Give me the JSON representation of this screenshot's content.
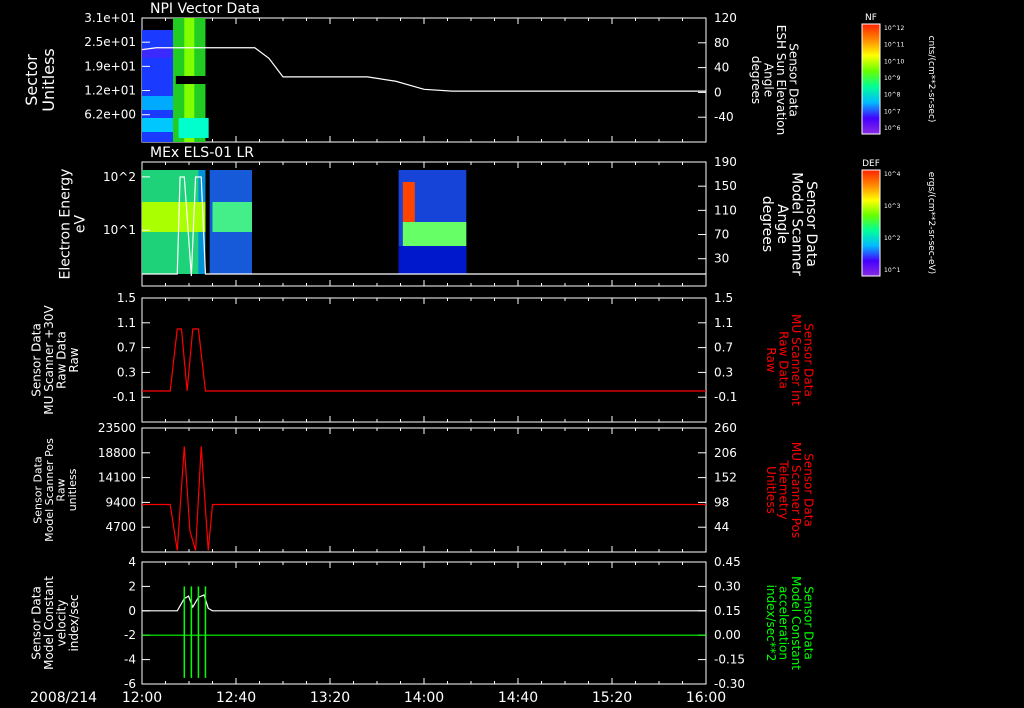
{
  "date_label": "2008/214",
  "time_ticks": [
    "12:00",
    "12:40",
    "13:20",
    "14:00",
    "14:40",
    "15:20",
    "16:00"
  ],
  "colorbars": [
    {
      "tag": "NF",
      "units": "cnts/(cm**2-sr-sec)",
      "labels": [
        "10^12",
        "10^11",
        "10^10",
        "10^9",
        "10^8",
        "10^7",
        "10^6"
      ]
    },
    {
      "tag": "DEF",
      "units": "ergs/(cm**2-sr-sec-eV)",
      "labels": [
        "10^4",
        "10^3",
        "10^2",
        "10^1"
      ]
    }
  ],
  "chart_data": [
    {
      "type": "heatmap",
      "title": "NPI Vector Data",
      "ylabel": [
        "Sector",
        "Unitless"
      ],
      "yticks": [
        "3.1e+01",
        "2.5e+01",
        "1.9e+01",
        "1.2e+01",
        "6.2e+00"
      ],
      "right_ylabel": [
        "Sensor Data",
        "ESH Sun Elevation",
        "Angle",
        "degrees"
      ],
      "right_ticks": [
        "120",
        "80",
        "40",
        "0",
        "-40"
      ],
      "right_ylim": [
        -80,
        120
      ],
      "xlim_hours": [
        12,
        16
      ],
      "overlay_line": {
        "x": [
          12.0,
          12.1,
          12.2,
          12.3,
          12.4,
          12.5,
          12.6,
          12.8,
          12.9,
          13.0,
          13.2,
          13.4,
          13.6,
          13.8,
          14.0,
          14.2,
          14.4,
          14.6,
          14.8,
          15.0,
          15.2,
          15.4,
          15.6,
          15.8,
          16.0
        ],
        "y": [
          69,
          72,
          72,
          72,
          72,
          72,
          72,
          72,
          55,
          25,
          25,
          25,
          25,
          18,
          5,
          2,
          2,
          2,
          2,
          2,
          2,
          2,
          2,
          2,
          2
        ]
      }
    },
    {
      "type": "heatmap",
      "title": "MEx ELS-01 LR",
      "ylabel": [
        "Electron Energy",
        "eV"
      ],
      "yticks": [
        "10^2",
        "10^1"
      ],
      "right_ylabel": [
        "Sensor Data",
        "Model Scanner",
        "Angle",
        "degrees"
      ],
      "right_ticks": [
        "190",
        "150",
        "110",
        "70",
        "30"
      ],
      "right_ylim": [
        10,
        190
      ]
    },
    {
      "type": "line",
      "ylabel": [
        "Sensor Data",
        "MU Scanner +30V",
        "Raw Data",
        "Raw"
      ],
      "yticks": [
        "1.5",
        "1.1",
        "0.7",
        "0.3",
        "-0.1"
      ],
      "ylim": [
        -0.5,
        1.5
      ],
      "right_ylabel": [
        "Sensor Data",
        "MU Scanner Int",
        "Raw Data",
        "Raw"
      ],
      "right_ticks": [
        "1.5",
        "1.1",
        "0.7",
        "0.3",
        "-0.1"
      ],
      "series": [
        {
          "color": "#ff0000",
          "x": [
            12.0,
            12.2,
            12.25,
            12.28,
            12.32,
            12.36,
            12.4,
            12.45,
            12.48,
            12.55,
            16.0
          ],
          "y": [
            0,
            0,
            1,
            1,
            0,
            1,
            1,
            0,
            0,
            0,
            0
          ]
        }
      ]
    },
    {
      "type": "line",
      "ylabel": [
        "Sensor Data",
        "Model Scanner Pos",
        "Raw",
        "unitless"
      ],
      "yticks": [
        "23500",
        "18800",
        "14100",
        "9400",
        "4700"
      ],
      "ylim": [
        0,
        23500
      ],
      "right_ylabel": [
        "Sensor Data",
        "MU Scanner Pos",
        "Telemetry",
        "Unitless"
      ],
      "right_ticks": [
        "260",
        "206",
        "152",
        "98",
        "44"
      ],
      "series": [
        {
          "color": "#ff0000",
          "x": [
            12.0,
            12.2,
            12.25,
            12.3,
            12.34,
            12.38,
            12.42,
            12.47,
            12.5,
            16.0
          ],
          "y": [
            9000,
            9000,
            300,
            20000,
            4000,
            300,
            20000,
            300,
            9000,
            9000
          ]
        }
      ]
    },
    {
      "type": "line",
      "ylabel": [
        "Sensor Data",
        "Model Constant",
        "velocity",
        "index/sec"
      ],
      "yticks": [
        "4",
        "2",
        "0",
        "-2",
        "-4",
        "-6"
      ],
      "ylim": [
        -6,
        4
      ],
      "right_ylabel": [
        "Sensor Data",
        "Model Constant",
        "acceleration",
        "index/sec**2"
      ],
      "right_ticks": [
        "0.45",
        "0.30",
        "0.15",
        "0.00",
        "-0.15",
        "-0.30"
      ],
      "series": [
        {
          "color": "#ffffff",
          "x": [
            12.0,
            12.25,
            12.3,
            12.33,
            12.36,
            12.4,
            12.44,
            12.47,
            12.5,
            16.0
          ],
          "y": [
            0,
            0,
            1.0,
            1.2,
            0.3,
            1.1,
            1.3,
            0.2,
            0,
            0
          ]
        },
        {
          "color": "#00ff00",
          "x": [
            12.0,
            16.0
          ],
          "y": [
            -2,
            -2
          ]
        }
      ]
    }
  ]
}
